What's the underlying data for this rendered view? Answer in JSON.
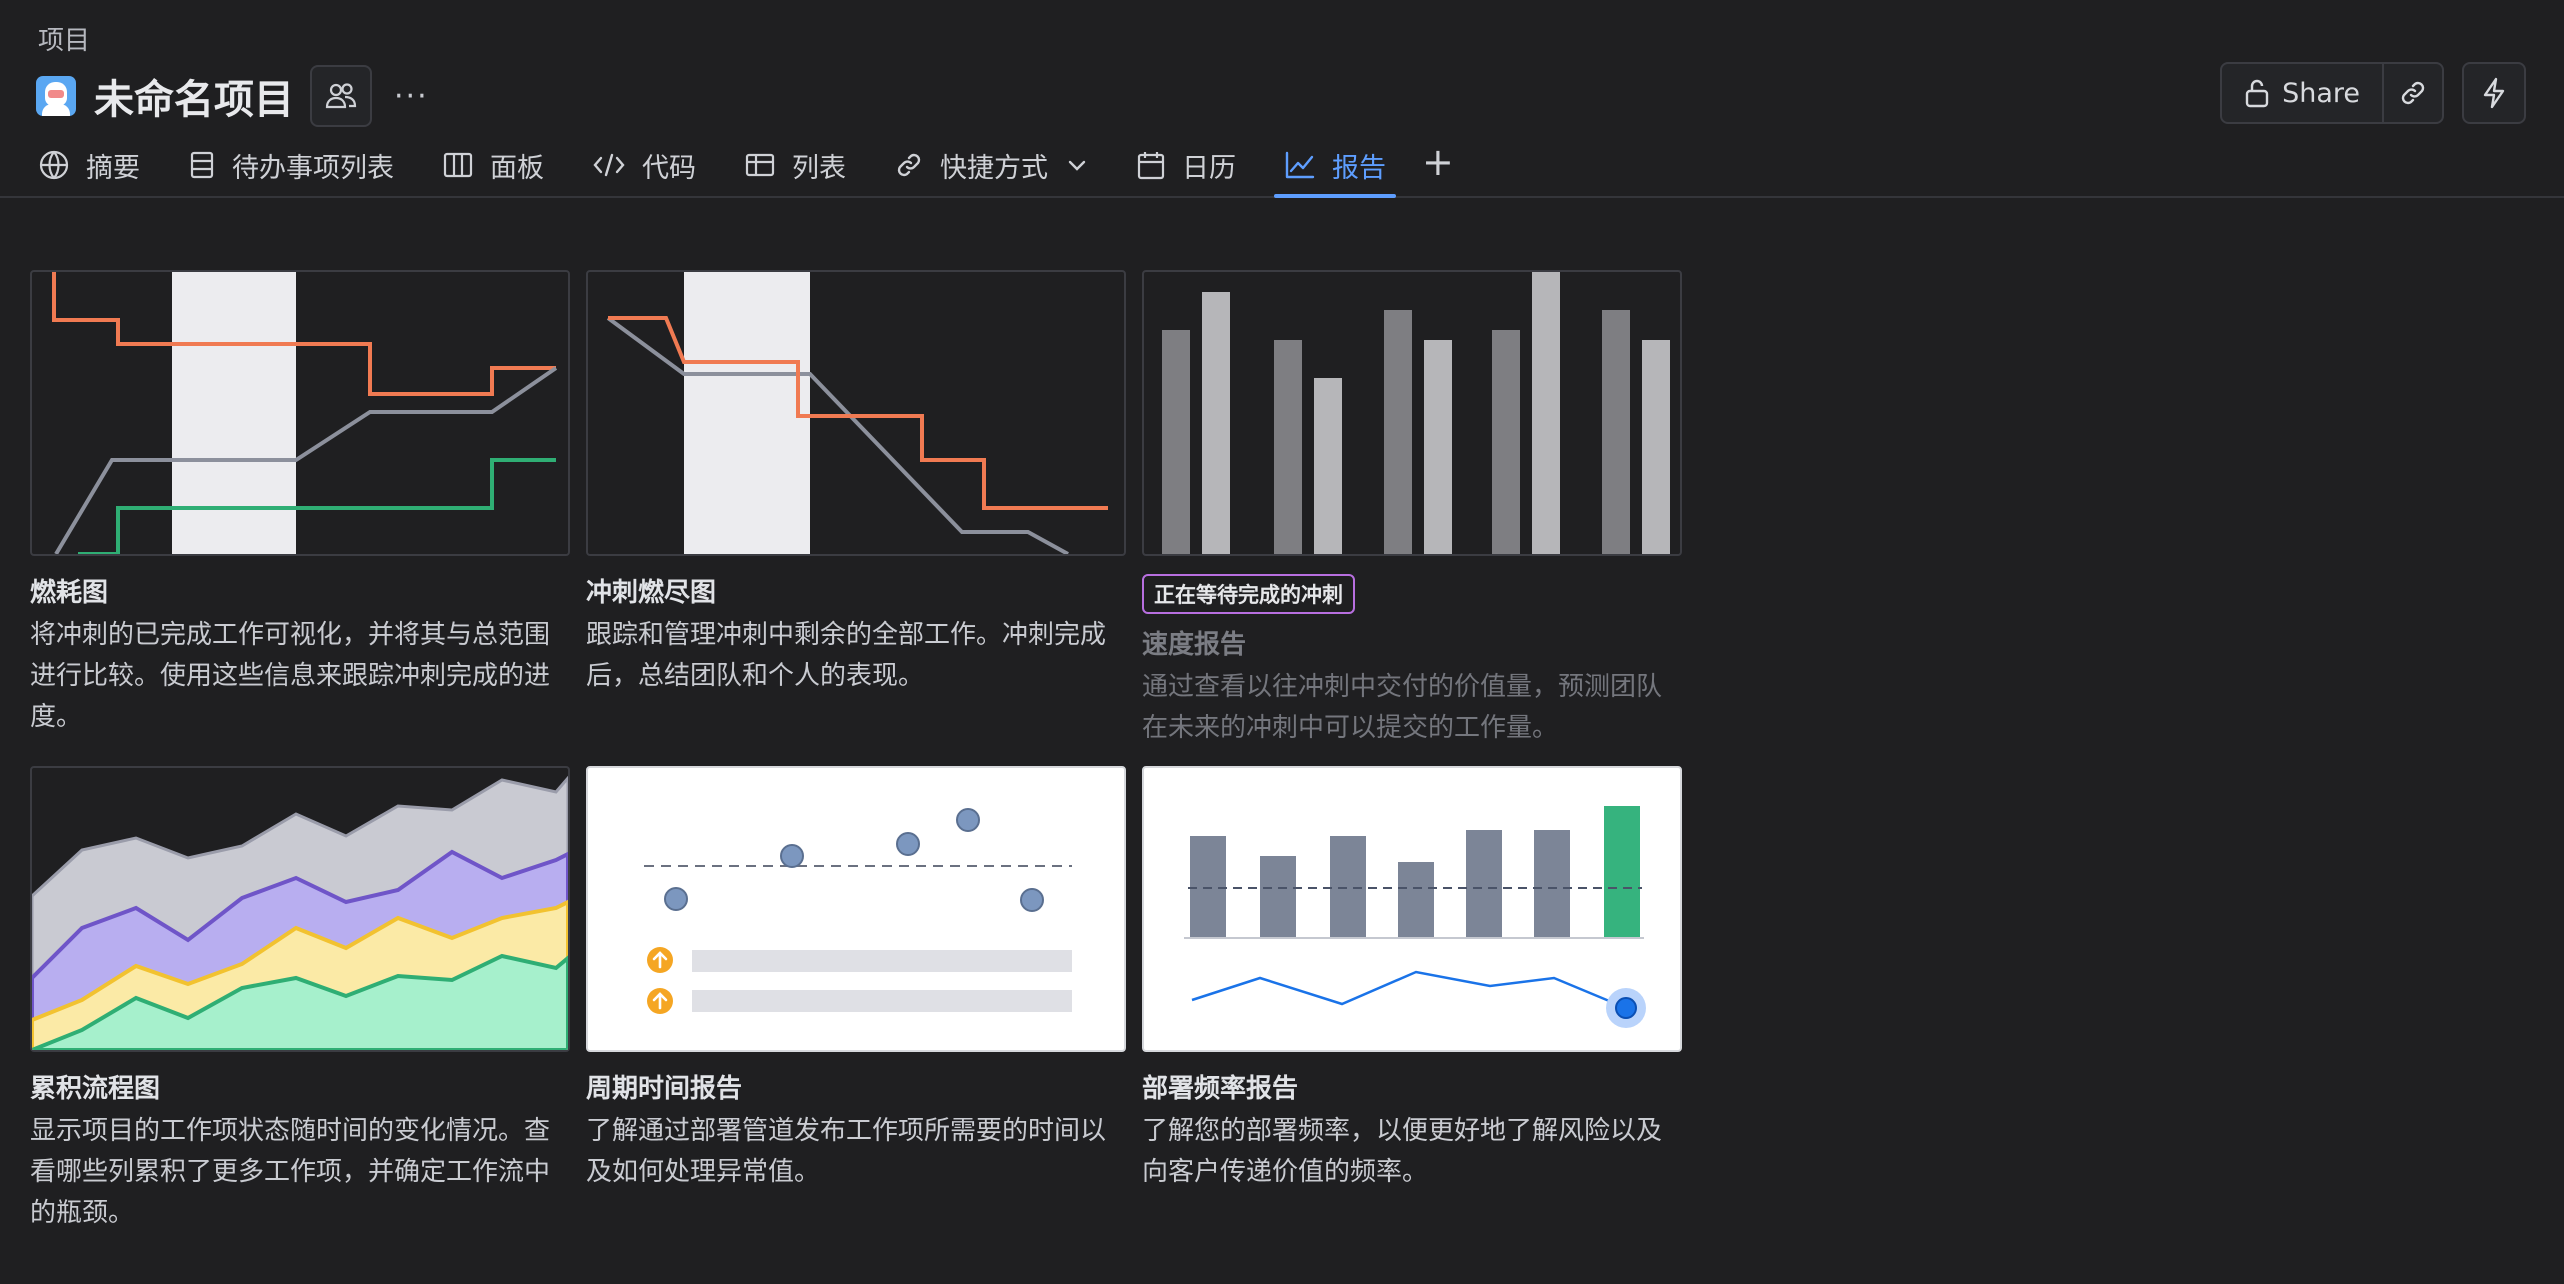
{
  "breadcrumb": "项目",
  "project_title": "未命名项目",
  "more_label": "···",
  "actions": {
    "share_label": "Share"
  },
  "tabs": [
    {
      "label": "摘要",
      "icon": "globe-icon"
    },
    {
      "label": "待办事项列表",
      "icon": "backlog-icon"
    },
    {
      "label": "面板",
      "icon": "board-icon"
    },
    {
      "label": "代码",
      "icon": "code-icon"
    },
    {
      "label": "列表",
      "icon": "list-icon"
    },
    {
      "label": "快捷方式",
      "icon": "link-icon"
    },
    {
      "label": "日历",
      "icon": "calendar-icon"
    },
    {
      "label": "报告",
      "icon": "chart-line-icon",
      "active": true
    }
  ],
  "add_tab_label": "+",
  "colors": {
    "accent": "#5e9eff",
    "orange": "#f07a52",
    "gray_line": "#8c909c",
    "green": "#2fae74",
    "purple_badge": "#b86fe0"
  },
  "reports": [
    {
      "title": "燃耗图",
      "description": "将冲刺的已完成工作可视化，并将其与总范围进行比较。使用这些信息来跟踪冲刺完成的进度。"
    },
    {
      "title": "冲刺燃尽图",
      "description": "跟踪和管理冲刺中剩余的全部工作。冲刺完成后，总结团队和个人的表现。"
    },
    {
      "badge": "正在等待完成的冲刺",
      "title": "速度报告",
      "description": "通过查看以往冲刺中交付的价值量，预测团队在未来的冲刺中可以提交的工作量。"
    },
    {
      "title": "累积流程图",
      "description": "显示项目的工作项状态随时间的变化情况。查看哪些列累积了更多工作项，并确定工作流中的瓶颈。"
    },
    {
      "title": "周期时间报告",
      "description": "了解通过部署管道发布工作项所需要的时间以及如何处理异常值。"
    },
    {
      "title": "部署频率报告",
      "description": "了解您的部署频率，以便更好地了解风险以及向客户传递价值的频率。"
    }
  ]
}
